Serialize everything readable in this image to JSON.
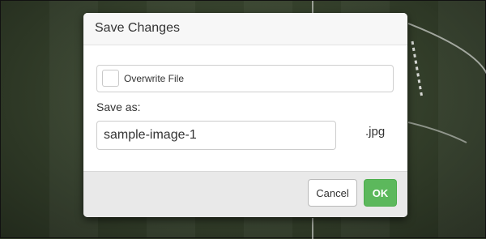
{
  "dialog": {
    "title": "Save Changes",
    "overwrite_label": "Overwrite File",
    "overwrite_checked": false,
    "save_as_label": "Save as:",
    "filename_value": "sample-image-1",
    "extension": ".jpg",
    "cancel_label": "Cancel",
    "ok_label": "OK"
  },
  "colors": {
    "ok_button": "#5cb85c",
    "background_field": "#323d29"
  }
}
